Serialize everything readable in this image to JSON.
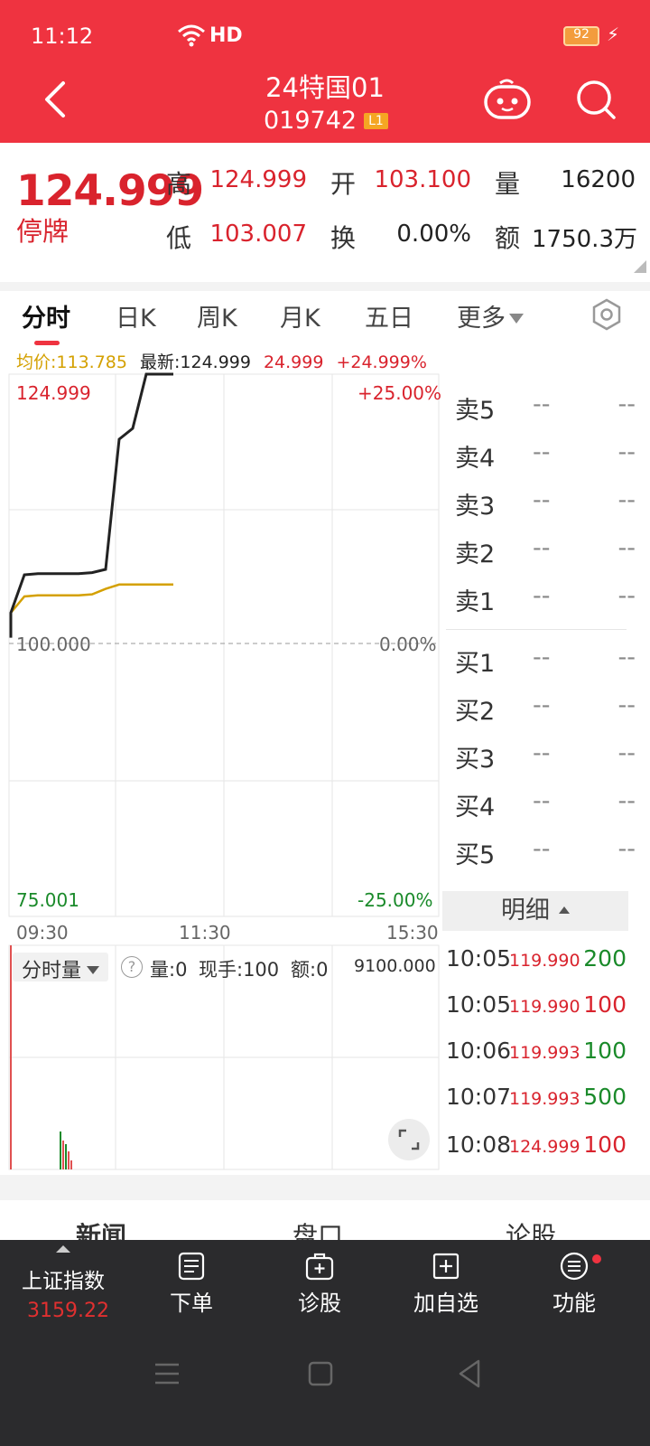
{
  "status_bar": {
    "time": "11:12",
    "network": "HD",
    "battery": "92"
  },
  "header": {
    "title": "24特国01",
    "code": "019742",
    "level_badge": "L1"
  },
  "quote": {
    "price": "124.999",
    "status": "停牌",
    "high_label": "高",
    "high": "124.999",
    "open_label": "开",
    "open": "103.100",
    "volume_label": "量",
    "volume": "16200",
    "low_label": "低",
    "low": "103.007",
    "turnover_label": "换",
    "turnover": "0.00%",
    "amount_label": "额",
    "amount": "1750.3万"
  },
  "tabs": [
    "分时",
    "日K",
    "周K",
    "月K",
    "五日",
    "更多"
  ],
  "legend": {
    "avg": "均价:113.785",
    "last": "最新:124.999",
    "change": "24.999",
    "change_pct": "+24.999%"
  },
  "chart_labels": {
    "y_top": "124.999",
    "pct_top": "+25.00%",
    "y_mid": "100.000",
    "pct_mid": "0.00%",
    "y_bot": "75.001",
    "pct_bot": "-25.00%",
    "t_start": "09:30",
    "t_mid": "11:30",
    "t_end": "15:30"
  },
  "chart_data": {
    "type": "line",
    "ylim": [
      75.001,
      124.999
    ],
    "xlabels": [
      "09:30",
      "11:30",
      "15:30"
    ],
    "series": [
      {
        "name": "最新",
        "color": "#222222",
        "x": [
          0,
          1,
          2,
          3,
          4,
          5,
          6,
          7,
          8,
          9,
          10,
          11,
          12
        ],
        "values": [
          103.0,
          106.5,
          106.6,
          106.6,
          106.6,
          106.6,
          106.7,
          107.0,
          119.0,
          120.0,
          124.999,
          124.999,
          124.999
        ]
      },
      {
        "name": "均价",
        "color": "#d4a000",
        "x": [
          0,
          1,
          2,
          3,
          4,
          5,
          6,
          7,
          8,
          9,
          10,
          11,
          12
        ],
        "values": [
          103.0,
          104.5,
          104.6,
          104.6,
          104.6,
          104.6,
          104.7,
          105.2,
          105.6,
          105.6,
          105.6,
          105.6,
          105.6
        ]
      }
    ]
  },
  "order_book": {
    "sell": [
      {
        "label": "卖5",
        "price": "--",
        "vol": "--"
      },
      {
        "label": "卖4",
        "price": "--",
        "vol": "--"
      },
      {
        "label": "卖3",
        "price": "--",
        "vol": "--"
      },
      {
        "label": "卖2",
        "price": "--",
        "vol": "--"
      },
      {
        "label": "卖1",
        "price": "--",
        "vol": "--"
      }
    ],
    "buy": [
      {
        "label": "买1",
        "price": "--",
        "vol": "--"
      },
      {
        "label": "买2",
        "price": "--",
        "vol": "--"
      },
      {
        "label": "买3",
        "price": "--",
        "vol": "--"
      },
      {
        "label": "买4",
        "price": "--",
        "vol": "--"
      },
      {
        "label": "买5",
        "price": "--",
        "vol": "--"
      }
    ]
  },
  "details": {
    "title": "明细",
    "trades": [
      {
        "time": "10:05",
        "price": "119.990",
        "vol": "200",
        "dir": "green"
      },
      {
        "time": "10:05",
        "price": "119.990",
        "vol": "100",
        "dir": "red"
      },
      {
        "time": "10:06",
        "price": "119.993",
        "vol": "100",
        "dir": "green"
      },
      {
        "time": "10:07",
        "price": "119.993",
        "vol": "500",
        "dir": "green"
      },
      {
        "time": "10:08",
        "price": "124.999",
        "vol": "100",
        "dir": "red"
      }
    ]
  },
  "volume_panel": {
    "selector": "分时量",
    "help": "?",
    "vol": "量:0",
    "hand": "现手:100",
    "amount": "额:0",
    "max": "9100.000"
  },
  "bottom_tabs": [
    "新闻",
    "盘口",
    "论股"
  ],
  "bottom_bar": {
    "index_name": "上证指数",
    "index_value": "3159.22",
    "order": "下单",
    "diagnose": "诊股",
    "add_watch": "加自选",
    "functions": "功能"
  },
  "colors": {
    "header": "#ef3340",
    "up": "#d9232d",
    "down": "#1a8a2a",
    "avg_line": "#d4a000"
  }
}
